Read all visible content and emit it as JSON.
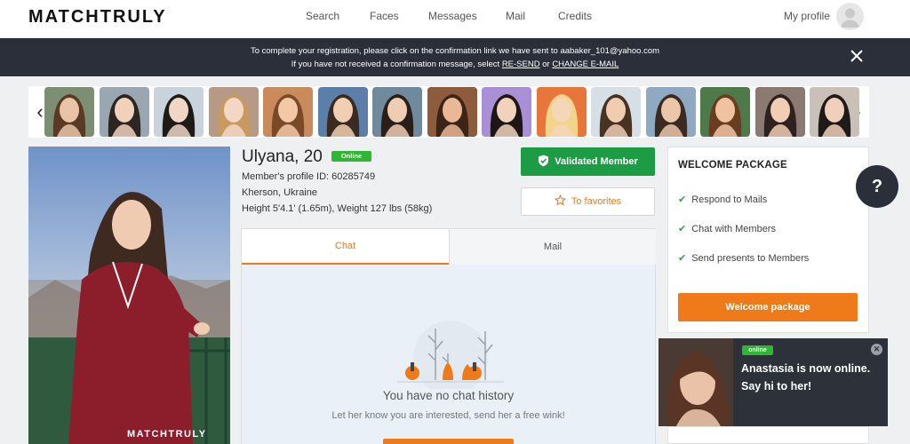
{
  "header": {
    "logo": "MATCHTRULY",
    "nav": [
      {
        "label": "Search",
        "name": "nav-search"
      },
      {
        "label": "Faces",
        "name": "nav-faces"
      },
      {
        "label": "Messages",
        "name": "nav-messages"
      },
      {
        "label": "Mail",
        "name": "nav-mail"
      },
      {
        "label": "Credits",
        "name": "nav-credits"
      }
    ],
    "profile_label": "My profile"
  },
  "banner": {
    "line1": "To complete your registration, please click on the confirmation link we have sent to aabaker_101@yahoo.com",
    "line2_prefix": "If you have not received a confirmation message, select ",
    "resend": "RE-SEND",
    "or": " or ",
    "change_email": "CHANGE E-MAIL"
  },
  "carousel": {
    "thumbs": [
      {
        "bg": "#7d8f72",
        "skin": "#e9c4a8",
        "hair": "#5a3a24"
      },
      {
        "bg": "#9aa7b3",
        "skin": "#f0d2bb",
        "hair": "#2c2522"
      },
      {
        "bg": "#c9d3dc",
        "skin": "#f0d6c4",
        "hair": "#1e1a18"
      },
      {
        "bg": "#b69a86",
        "skin": "#f2d7c4",
        "hair": "#c89a62"
      },
      {
        "bg": "#c98b5c",
        "skin": "#f3c8a8",
        "hair": "#7a4a28"
      },
      {
        "bg": "#5b7fa8",
        "skin": "#f1cfb4",
        "hair": "#3a2a20"
      },
      {
        "bg": "#6f8a9c",
        "skin": "#efcdb2",
        "hair": "#2a1e18"
      },
      {
        "bg": "#8c5c3c",
        "skin": "#eab896",
        "hair": "#3c2416"
      },
      {
        "bg": "#a98fd6",
        "skin": "#f1d3bd",
        "hair": "#1d1614"
      },
      {
        "bg": "#e8763a",
        "skin": "#f6d6b8",
        "hair": "#f2d58a"
      },
      {
        "bg": "#d7dfe6",
        "skin": "#f0cdb1",
        "hair": "#4a3222"
      },
      {
        "bg": "#8fa9c3",
        "skin": "#ecc6a9",
        "hair": "#3a2a22"
      },
      {
        "bg": "#4e7a4a",
        "skin": "#efc3a2",
        "hair": "#6a3c22"
      },
      {
        "bg": "#8a7a72",
        "skin": "#f0cdb3",
        "hair": "#2e2220"
      },
      {
        "bg": "#c9c1b8",
        "skin": "#f0d0ba",
        "hair": "#1f1a18"
      }
    ]
  },
  "profile": {
    "name": "Ulyana, 20",
    "status": "Online",
    "profile_id": "Member's profile ID: 60285749",
    "location": "Kherson, Ukraine",
    "measurements": "Height 5'4.1' (1.65m), Weight 127 lbs (58kg)",
    "watermark": "MATCHTRULY",
    "validated_label": "Validated Member",
    "favorites_label": "To favorites"
  },
  "tabs": {
    "chat": "Chat",
    "mail": "Mail"
  },
  "chat": {
    "empty_title": "You have no chat history",
    "empty_subtitle": "Let her know you are interested, send her a free wink!"
  },
  "welcome": {
    "title": "WELCOME PACKAGE",
    "items": [
      "Respond to Mails",
      "Chat with Members",
      "Send presents to Members"
    ],
    "button": "Welcome package"
  },
  "help": {
    "label": "?"
  },
  "notification": {
    "badge": "online",
    "text": "Anastasia is now online. Say hi to her!"
  },
  "colors": {
    "accent": "#ee7a1a",
    "validated": "#1e9b45",
    "online": "#2fb633",
    "banner": "#2b2f3a"
  }
}
